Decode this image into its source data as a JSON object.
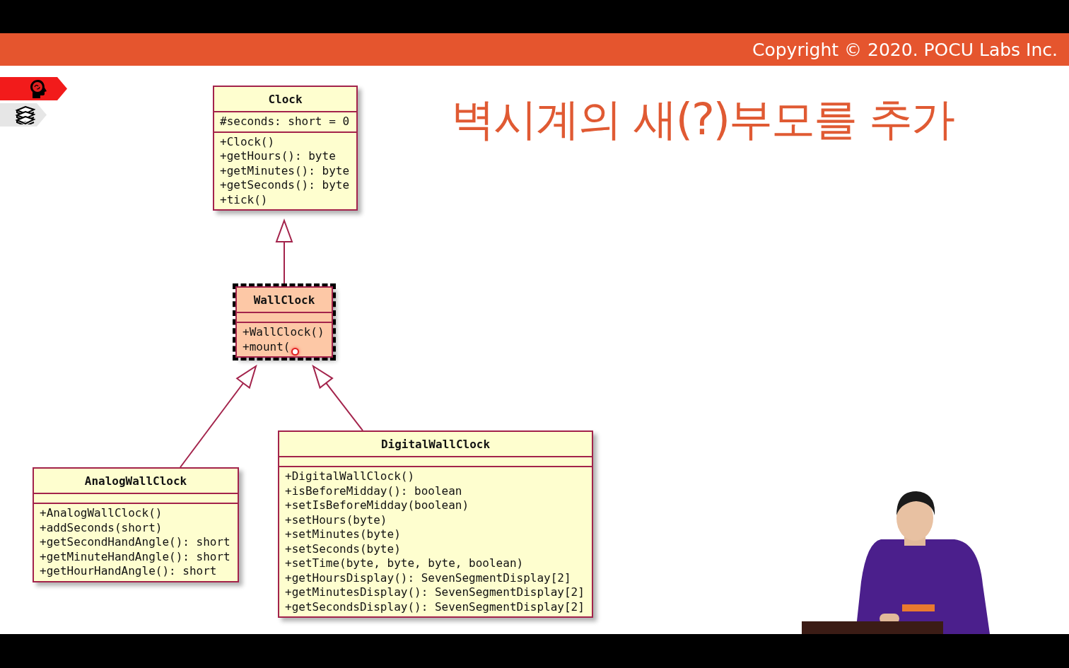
{
  "header": {
    "copyright": "Copyright © 2020. POCU Labs Inc."
  },
  "nav_tabs": [
    {
      "kind": "brain",
      "selected": true
    },
    {
      "kind": "books",
      "selected": false
    }
  ],
  "title": "벽시계의 새(?)부모를 추가",
  "classes": [
    {
      "name": "Clock",
      "highlighted": false,
      "attributes": [
        "#seconds: short = 0"
      ],
      "methods": [
        "+Clock()",
        "+getHours(): byte",
        "+getMinutes(): byte",
        "+getSeconds(): byte",
        "+tick()"
      ]
    },
    {
      "name": "WallClock",
      "highlighted": true,
      "methods": [
        "+WallClock()",
        "+mount("
      ]
    },
    {
      "name": "AnalogWallClock",
      "highlighted": false,
      "methods": [
        "+AnalogWallClock()",
        "+addSeconds(short)",
        "+getSecondHandAngle(): short",
        "+getMinuteHandAngle(): short",
        "+getHourHandAngle(): short"
      ]
    },
    {
      "name": "DigitalWallClock",
      "highlighted": false,
      "methods": [
        "+DigitalWallClock()",
        "+isBeforeMidday(): boolean",
        "+setIsBeforeMidday(boolean)",
        "+setHours(byte)",
        "+setMinutes(byte)",
        "+setSeconds(byte)",
        "+setTime(byte, byte, byte, boolean)",
        "+getHoursDisplay(): SevenSegmentDisplay[2]",
        "+getMinutesDisplay(): SevenSegmentDisplay[2]",
        "+getSecondsDisplay(): SevenSegmentDisplay[2]"
      ]
    }
  ]
}
